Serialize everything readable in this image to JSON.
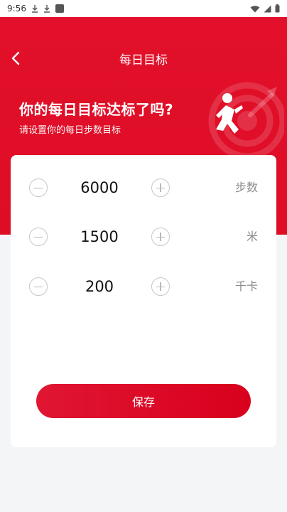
{
  "status_bar": {
    "time": "9:56"
  },
  "header": {
    "title": "每日目标",
    "headline": "你的每日目标达标了吗?",
    "subline": "请设置你的每日步数目标",
    "accent_color": "#e2102a"
  },
  "goals": [
    {
      "value": "6000",
      "unit": "步数"
    },
    {
      "value": "1500",
      "unit": "米"
    },
    {
      "value": "200",
      "unit": "千卡"
    }
  ],
  "actions": {
    "save_label": "保存"
  },
  "icons": [
    "back-arrow-icon",
    "minus-icon",
    "plus-icon",
    "runner-target-icon",
    "download-icon",
    "wifi-icon",
    "signal-icon",
    "battery-icon"
  ]
}
